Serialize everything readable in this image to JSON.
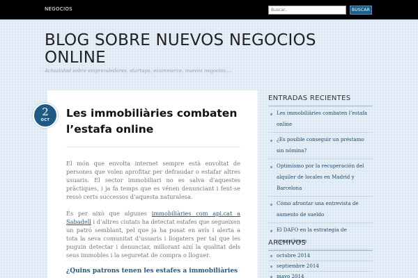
{
  "topbar": {
    "nav_label": "NEGOCIOS",
    "search_placeholder": "Buscar..",
    "search_button": "BUSCAR"
  },
  "site": {
    "title": "BLOG SOBRE NUEVOS NEGOCIOS ONLINE",
    "description": "Actualidad sobre emprendedores, startups, ecommerce, nuevos negocios,..."
  },
  "post": {
    "day": "2",
    "month": "OCT",
    "title": "Les immobiliàries combaten l’estafa online",
    "para1": "El món que envolta internet sempre està envoltat de persones que volen aprofitar per defraudar o estafar altres usuaris. El sector immobiliari no es salva d’aquestes pràctiques, i ja fa temps que es vénen denunciant i fent-se ressò certs successos d’aquesta naturalesa.",
    "para2_before": "És per això que algunes ",
    "para2_link": "immobiliàries com api.cat a Sabadell",
    "para2_after": " i d’altres ciutats ha detectat estafes que segueixen un patró semblant, pel que ja ha posat en avís i alerta a tota la seva comunitat d’usuaris i llogaters per tal que les puguin detectar i denunciar, millorant així la qualitat dels seus immobles i la seguretat de compra o lloguer.",
    "subheading": "¿Quins patrons tenen les estafes a immobiliàries"
  },
  "sidebar": {
    "recent_title": "ENTRADAS RECIENTES",
    "recent": [
      "Les immobiliàries combaten l’estafa online",
      "¿Es posible conseguir un préstamo sin nómina?",
      "Optimismo por la recuperación del alquiler de locales en Madrid y Barcelona",
      "Cómo afrontar una entrevista de aumento de sueldo",
      "El DAFO en la estrategia de operaciones"
    ],
    "archive_title": "ARCHIVOS",
    "archives": [
      "octubre 2014",
      "septiembre 2014",
      "mayo 2014"
    ]
  }
}
